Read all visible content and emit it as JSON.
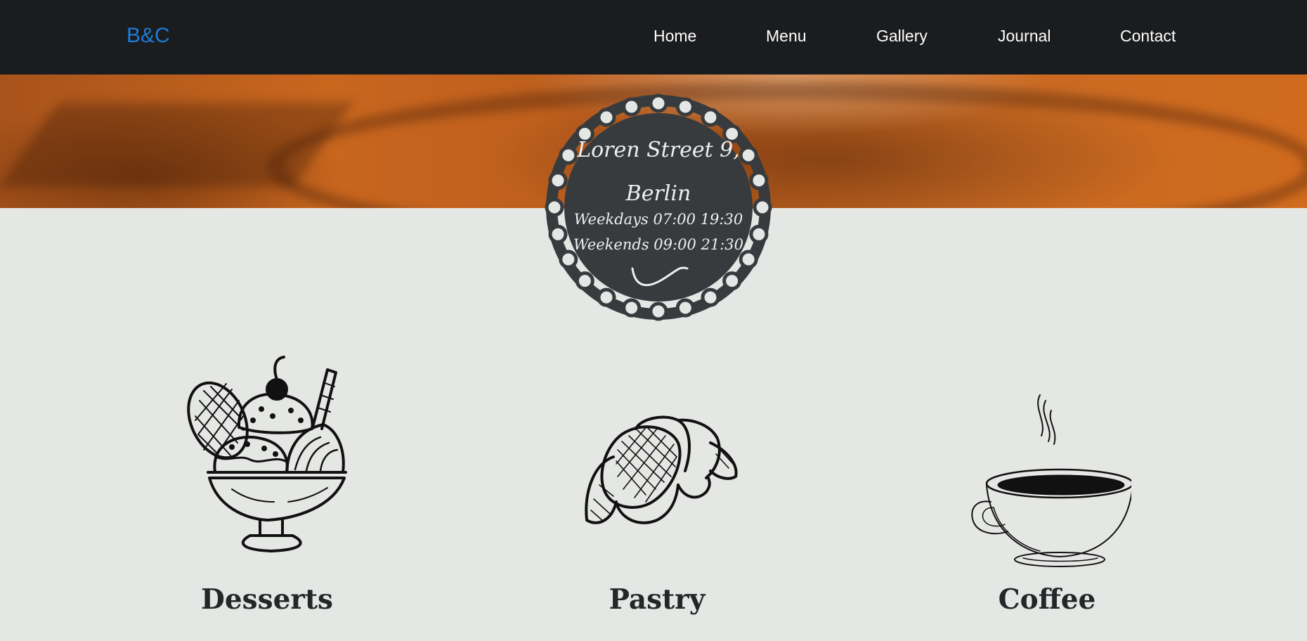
{
  "brand": "B&C",
  "nav": {
    "home": "Home",
    "menu": "Menu",
    "gallery": "Gallery",
    "journal": "Journal",
    "contact": "Contact"
  },
  "emblem": {
    "address_line1": "Loren Street 9,",
    "address_line2": "Berlin",
    "hours_weekdays": "Weekdays 07:00 19:30",
    "hours_weekends": "Weekends 09:00 21:30"
  },
  "categories": {
    "desserts": "Desserts",
    "pastry": "Pastry",
    "coffee": "Coffee"
  },
  "colors": {
    "navbar_bg": "#1b1c1e",
    "brand": "#1e7bd8",
    "page_bg": "#e5e7e4",
    "emblem_bg": "#373b3e",
    "heading": "#24272a"
  },
  "icons": [
    "ice-cream-sundae-icon",
    "croissant-icon",
    "coffee-cup-icon"
  ]
}
